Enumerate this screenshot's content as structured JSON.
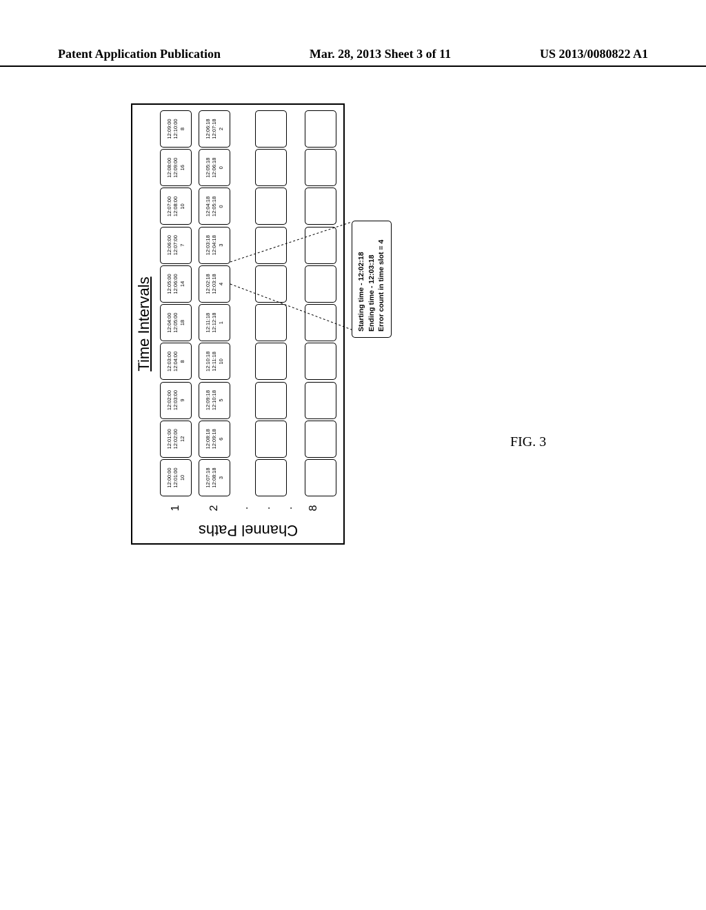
{
  "header": {
    "left": "Patent Application Publication",
    "center": "Mar. 28, 2013  Sheet 3 of 11",
    "right": "US 2013/0080822 A1"
  },
  "figure": {
    "label": "FIG. 3",
    "title_top": "Time Intervals",
    "title_left": "Channel Paths",
    "row_labels": [
      "1",
      "2",
      ".",
      ".",
      ".",
      "8"
    ],
    "row1": [
      {
        "t1": "12:00:00",
        "t2": "12:01:00",
        "v": "10"
      },
      {
        "t1": "12:01:00",
        "t2": "12:02:00",
        "v": "12"
      },
      {
        "t1": "12:02:00",
        "t2": "12:03:00",
        "v": "9"
      },
      {
        "t1": "12:03:00",
        "t2": "12:04:00",
        "v": "8"
      },
      {
        "t1": "12:04:00",
        "t2": "12:05:00",
        "v": "18"
      },
      {
        "t1": "12:05:00",
        "t2": "12:06:00",
        "v": "14"
      },
      {
        "t1": "12:06:00",
        "t2": "12:07:00",
        "v": "7"
      },
      {
        "t1": "12:07:00",
        "t2": "12:08:00",
        "v": "10"
      },
      {
        "t1": "12:08:00",
        "t2": "12:09:00",
        "v": "16"
      },
      {
        "t1": "12:09:00",
        "t2": "12:10:00",
        "v": "8"
      }
    ],
    "row2": [
      {
        "t1": "12:07:18",
        "t2": "12:08:18",
        "v": "3"
      },
      {
        "t1": "12:08:18",
        "t2": "12:09:18",
        "v": "6"
      },
      {
        "t1": "12:09:18",
        "t2": "12:10:18",
        "v": "5"
      },
      {
        "t1": "12:10:18",
        "t2": "12:11:18",
        "v": "10"
      },
      {
        "t1": "12:11:18",
        "t2": "12:12:18",
        "v": "1"
      },
      {
        "t1": "12:02:18",
        "t2": "12:03:18",
        "v": "4"
      },
      {
        "t1": "12:03:18",
        "t2": "12:04:18",
        "v": "3"
      },
      {
        "t1": "12:04:18",
        "t2": "12:05:18",
        "v": "0"
      },
      {
        "t1": "12:05:18",
        "t2": "12:06:18",
        "v": "0"
      },
      {
        "t1": "12:06:18",
        "t2": "12:07:18",
        "v": "2"
      }
    ],
    "callout": {
      "line1": "Starting time - 12:02:18",
      "line2": "Ending time - 12:03:18",
      "line3": "Error count in time slot = 4"
    }
  },
  "chart_data": {
    "type": "table",
    "title": "Time Intervals by Channel Path — error counts per 1-minute interval",
    "xlabel": "Time Intervals",
    "ylabel": "Channel Paths",
    "series": [
      {
        "name": "Channel Path 1",
        "intervals": [
          {
            "start": "12:00:00",
            "end": "12:01:00",
            "errors": 10
          },
          {
            "start": "12:01:00",
            "end": "12:02:00",
            "errors": 12
          },
          {
            "start": "12:02:00",
            "end": "12:03:00",
            "errors": 9
          },
          {
            "start": "12:03:00",
            "end": "12:04:00",
            "errors": 8
          },
          {
            "start": "12:04:00",
            "end": "12:05:00",
            "errors": 18
          },
          {
            "start": "12:05:00",
            "end": "12:06:00",
            "errors": 14
          },
          {
            "start": "12:06:00",
            "end": "12:07:00",
            "errors": 7
          },
          {
            "start": "12:07:00",
            "end": "12:08:00",
            "errors": 10
          },
          {
            "start": "12:08:00",
            "end": "12:09:00",
            "errors": 16
          },
          {
            "start": "12:09:00",
            "end": "12:10:00",
            "errors": 8
          }
        ]
      },
      {
        "name": "Channel Path 2",
        "intervals": [
          {
            "start": "12:07:18",
            "end": "12:08:18",
            "errors": 3
          },
          {
            "start": "12:08:18",
            "end": "12:09:18",
            "errors": 6
          },
          {
            "start": "12:09:18",
            "end": "12:10:18",
            "errors": 5
          },
          {
            "start": "12:10:18",
            "end": "12:11:18",
            "errors": 10
          },
          {
            "start": "12:11:18",
            "end": "12:12:18",
            "errors": 1
          },
          {
            "start": "12:02:18",
            "end": "12:03:18",
            "errors": 4
          },
          {
            "start": "12:03:18",
            "end": "12:04:18",
            "errors": 3
          },
          {
            "start": "12:04:18",
            "end": "12:05:18",
            "errors": 0
          },
          {
            "start": "12:05:18",
            "end": "12:06:18",
            "errors": 0
          },
          {
            "start": "12:06:18",
            "end": "12:07:18",
            "errors": 2
          }
        ]
      }
    ],
    "callout_detail": {
      "start": "12:02:18",
      "end": "12:03:18",
      "errors": 4
    }
  }
}
